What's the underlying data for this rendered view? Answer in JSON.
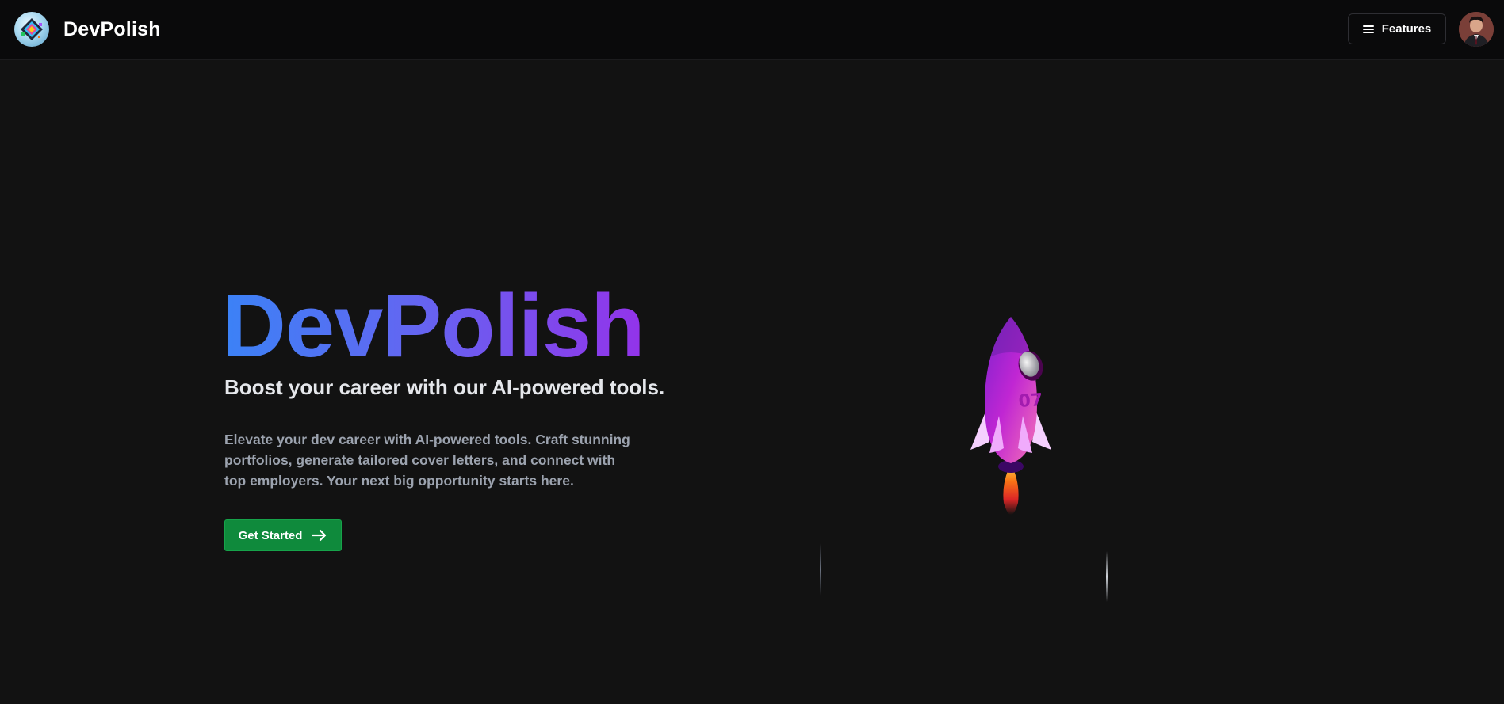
{
  "navbar": {
    "brand_name": "DevPolish",
    "features_label": "Features"
  },
  "hero": {
    "title": "DevPolish",
    "subtitle": "Boost your career with our AI-powered tools.",
    "description": "Elevate your dev career with AI-powered tools. Craft stunning portfolios, generate tailored cover letters, and connect with top employers. Your next big opportunity starts here.",
    "cta_label": "Get Started"
  },
  "rocket": {
    "number_label": "07"
  },
  "colors": {
    "background": "#121212",
    "navbar": "#0a0a0b",
    "cta": "#0f8a3c",
    "gradient_start": "#3b82f6",
    "gradient_end": "#9333ea",
    "rocket": "#c026d3"
  },
  "icons": {
    "logo": "devpolish-logo",
    "menu": "menu-icon",
    "avatar": "user-avatar",
    "arrow": "arrow-right-icon"
  }
}
